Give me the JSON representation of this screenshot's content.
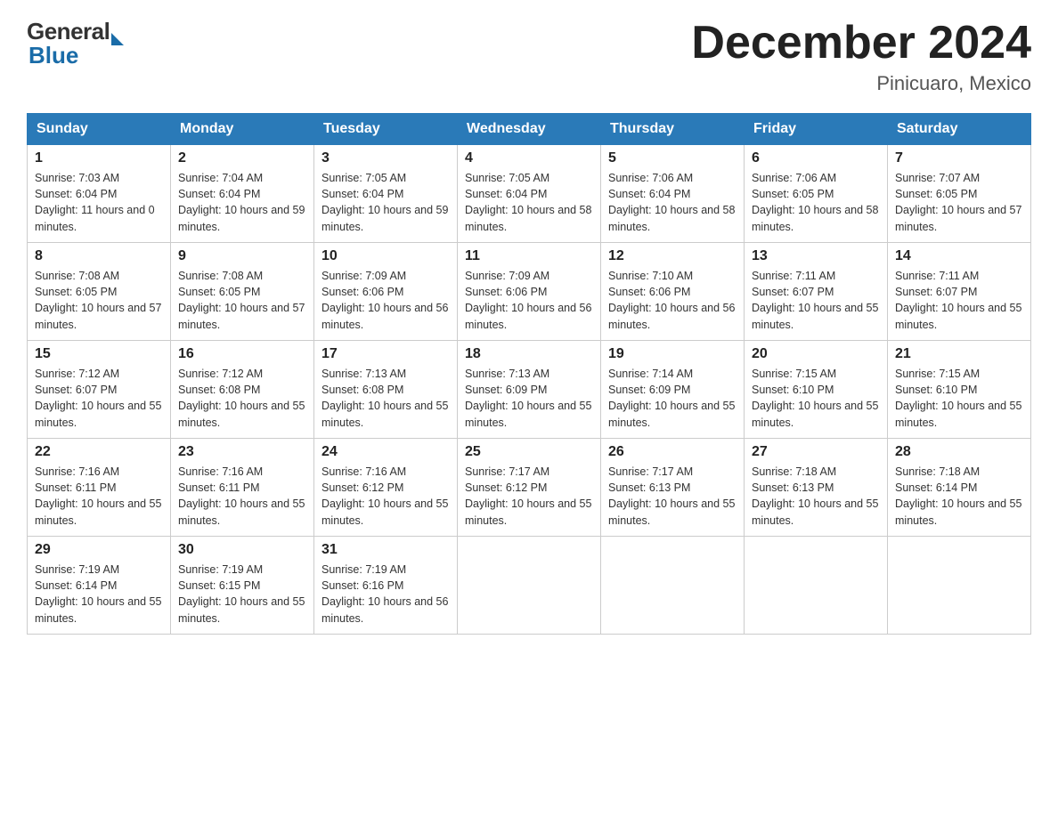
{
  "header": {
    "logo": {
      "general": "General",
      "blue": "Blue"
    },
    "title": "December 2024",
    "location": "Pinicuaro, Mexico"
  },
  "days_of_week": [
    "Sunday",
    "Monday",
    "Tuesday",
    "Wednesday",
    "Thursday",
    "Friday",
    "Saturday"
  ],
  "weeks": [
    [
      {
        "day": "1",
        "sunrise": "7:03 AM",
        "sunset": "6:04 PM",
        "daylight": "11 hours and 0 minutes."
      },
      {
        "day": "2",
        "sunrise": "7:04 AM",
        "sunset": "6:04 PM",
        "daylight": "10 hours and 59 minutes."
      },
      {
        "day": "3",
        "sunrise": "7:05 AM",
        "sunset": "6:04 PM",
        "daylight": "10 hours and 59 minutes."
      },
      {
        "day": "4",
        "sunrise": "7:05 AM",
        "sunset": "6:04 PM",
        "daylight": "10 hours and 58 minutes."
      },
      {
        "day": "5",
        "sunrise": "7:06 AM",
        "sunset": "6:04 PM",
        "daylight": "10 hours and 58 minutes."
      },
      {
        "day": "6",
        "sunrise": "7:06 AM",
        "sunset": "6:05 PM",
        "daylight": "10 hours and 58 minutes."
      },
      {
        "day": "7",
        "sunrise": "7:07 AM",
        "sunset": "6:05 PM",
        "daylight": "10 hours and 57 minutes."
      }
    ],
    [
      {
        "day": "8",
        "sunrise": "7:08 AM",
        "sunset": "6:05 PM",
        "daylight": "10 hours and 57 minutes."
      },
      {
        "day": "9",
        "sunrise": "7:08 AM",
        "sunset": "6:05 PM",
        "daylight": "10 hours and 57 minutes."
      },
      {
        "day": "10",
        "sunrise": "7:09 AM",
        "sunset": "6:06 PM",
        "daylight": "10 hours and 56 minutes."
      },
      {
        "day": "11",
        "sunrise": "7:09 AM",
        "sunset": "6:06 PM",
        "daylight": "10 hours and 56 minutes."
      },
      {
        "day": "12",
        "sunrise": "7:10 AM",
        "sunset": "6:06 PM",
        "daylight": "10 hours and 56 minutes."
      },
      {
        "day": "13",
        "sunrise": "7:11 AM",
        "sunset": "6:07 PM",
        "daylight": "10 hours and 55 minutes."
      },
      {
        "day": "14",
        "sunrise": "7:11 AM",
        "sunset": "6:07 PM",
        "daylight": "10 hours and 55 minutes."
      }
    ],
    [
      {
        "day": "15",
        "sunrise": "7:12 AM",
        "sunset": "6:07 PM",
        "daylight": "10 hours and 55 minutes."
      },
      {
        "day": "16",
        "sunrise": "7:12 AM",
        "sunset": "6:08 PM",
        "daylight": "10 hours and 55 minutes."
      },
      {
        "day": "17",
        "sunrise": "7:13 AM",
        "sunset": "6:08 PM",
        "daylight": "10 hours and 55 minutes."
      },
      {
        "day": "18",
        "sunrise": "7:13 AM",
        "sunset": "6:09 PM",
        "daylight": "10 hours and 55 minutes."
      },
      {
        "day": "19",
        "sunrise": "7:14 AM",
        "sunset": "6:09 PM",
        "daylight": "10 hours and 55 minutes."
      },
      {
        "day": "20",
        "sunrise": "7:15 AM",
        "sunset": "6:10 PM",
        "daylight": "10 hours and 55 minutes."
      },
      {
        "day": "21",
        "sunrise": "7:15 AM",
        "sunset": "6:10 PM",
        "daylight": "10 hours and 55 minutes."
      }
    ],
    [
      {
        "day": "22",
        "sunrise": "7:16 AM",
        "sunset": "6:11 PM",
        "daylight": "10 hours and 55 minutes."
      },
      {
        "day": "23",
        "sunrise": "7:16 AM",
        "sunset": "6:11 PM",
        "daylight": "10 hours and 55 minutes."
      },
      {
        "day": "24",
        "sunrise": "7:16 AM",
        "sunset": "6:12 PM",
        "daylight": "10 hours and 55 minutes."
      },
      {
        "day": "25",
        "sunrise": "7:17 AM",
        "sunset": "6:12 PM",
        "daylight": "10 hours and 55 minutes."
      },
      {
        "day": "26",
        "sunrise": "7:17 AM",
        "sunset": "6:13 PM",
        "daylight": "10 hours and 55 minutes."
      },
      {
        "day": "27",
        "sunrise": "7:18 AM",
        "sunset": "6:13 PM",
        "daylight": "10 hours and 55 minutes."
      },
      {
        "day": "28",
        "sunrise": "7:18 AM",
        "sunset": "6:14 PM",
        "daylight": "10 hours and 55 minutes."
      }
    ],
    [
      {
        "day": "29",
        "sunrise": "7:19 AM",
        "sunset": "6:14 PM",
        "daylight": "10 hours and 55 minutes."
      },
      {
        "day": "30",
        "sunrise": "7:19 AM",
        "sunset": "6:15 PM",
        "daylight": "10 hours and 55 minutes."
      },
      {
        "day": "31",
        "sunrise": "7:19 AM",
        "sunset": "6:16 PM",
        "daylight": "10 hours and 56 minutes."
      },
      null,
      null,
      null,
      null
    ]
  ]
}
